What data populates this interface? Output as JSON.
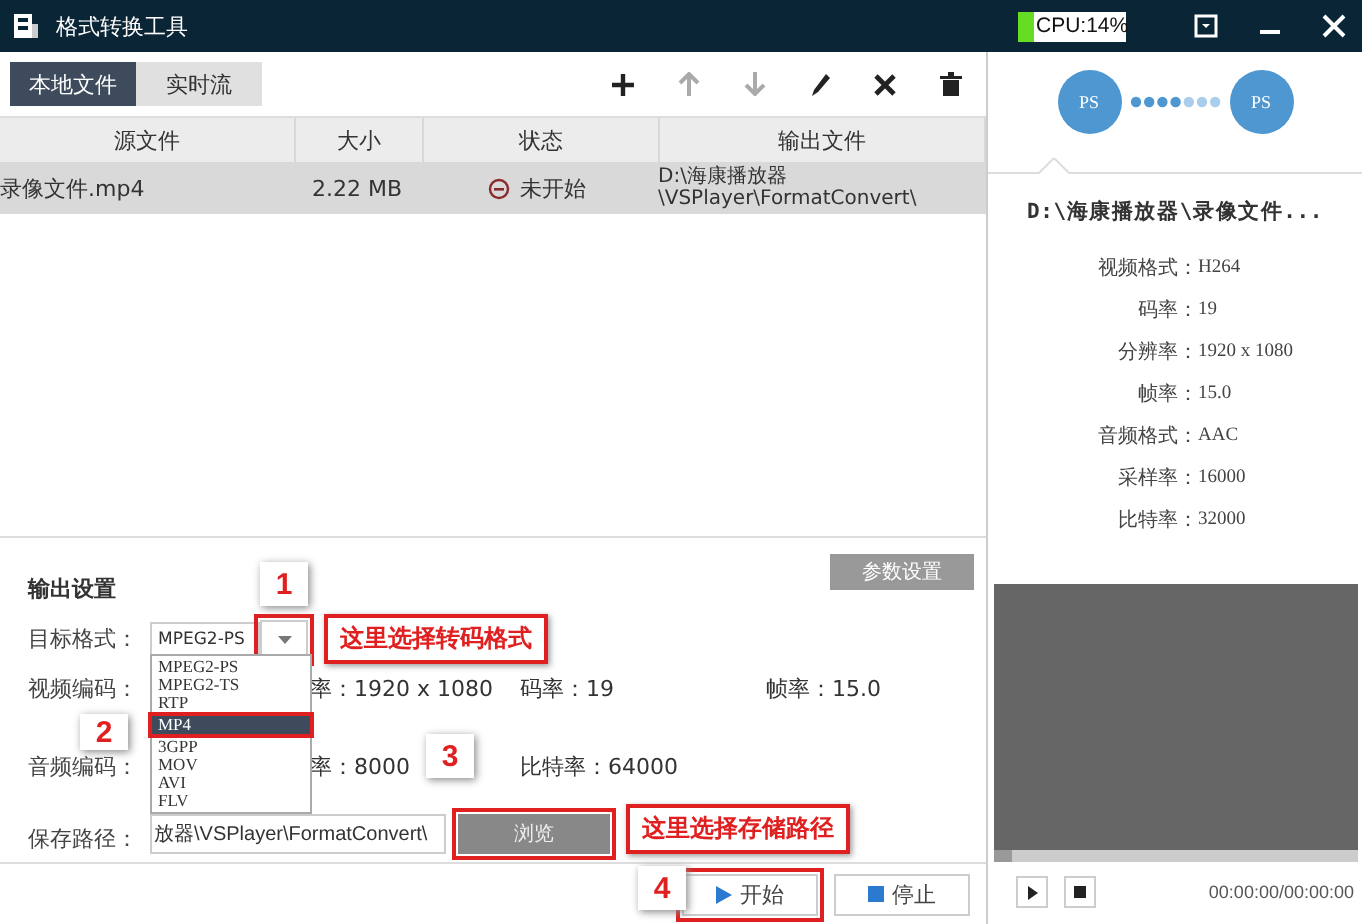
{
  "window": {
    "title": "格式转换工具",
    "cpu": {
      "label": "CPU:14%",
      "level": 0.14
    }
  },
  "tabs": [
    {
      "label": "本地文件",
      "selected": true
    },
    {
      "label": "实时流",
      "selected": false
    }
  ],
  "toolbar": [
    {
      "kind": "add",
      "disabled": false
    },
    {
      "kind": "up",
      "disabled": true
    },
    {
      "kind": "down",
      "disabled": true
    },
    {
      "kind": "edit",
      "disabled": false
    },
    {
      "kind": "remove",
      "disabled": false
    },
    {
      "kind": "trash",
      "disabled": false
    }
  ],
  "table": {
    "columns": [
      "源文件",
      "大小",
      "状态",
      "输出文件"
    ],
    "rows": [
      {
        "source": "录像文件.mp4",
        "size": "2.22 MB",
        "status": "未开始",
        "output": [
          "D:\\海康播放器",
          "\\VSPlayer\\FormatConvert\\"
        ],
        "selected": true
      }
    ]
  },
  "conversion": {
    "from": "PS",
    "to": "PS"
  },
  "info": {
    "path": "D:\\海康播放器\\录像文件...",
    "fields": [
      {
        "label": "视频格式：",
        "value": "H264"
      },
      {
        "label": "码率：",
        "value": "19"
      },
      {
        "label": "分辨率：",
        "value": "1920 x 1080"
      },
      {
        "label": "帧率：",
        "value": "15.0"
      },
      {
        "label": "音频格式：",
        "value": "AAC"
      },
      {
        "label": "采样率：",
        "value": "16000"
      },
      {
        "label": "比特率：",
        "value": "32000"
      }
    ]
  },
  "output_settings": {
    "title": "输出设置",
    "params_button": "参数设置",
    "format_label": "目标格式：",
    "format_value": "MPEG2-PS",
    "format_options": [
      {
        "label": "MPEG2-PS",
        "selected": false
      },
      {
        "label": "MPEG2-TS",
        "selected": false
      },
      {
        "label": "RTP",
        "selected": false
      },
      {
        "label": "MP4",
        "selected": true
      },
      {
        "label": "3GPP",
        "selected": false
      },
      {
        "label": "MOV",
        "selected": false
      },
      {
        "label": "AVI",
        "selected": false
      },
      {
        "label": "FLV",
        "selected": false
      }
    ],
    "video_label": "视频编码：",
    "resolution": "率：1920 x 1080",
    "video_bitrate": "码率：19",
    "framerate": "帧率：15.0",
    "audio_label": "音频编码：",
    "sample_rate": "率：8000",
    "audio_bitrate": "比特率：64000",
    "path_label": "保存路径：",
    "path_value": "放器\\VSPlayer\\FormatConvert\\",
    "browse": "浏览"
  },
  "actions": {
    "start": "开始",
    "stop": "停止"
  },
  "player": {
    "time": "00:00:00/00:00:00"
  },
  "annotations": [
    {
      "number": "1",
      "label": "这里选择转码格式"
    },
    {
      "number": "2"
    },
    {
      "number": "3",
      "label": "这里选择存储路径"
    },
    {
      "number": "4"
    }
  ]
}
